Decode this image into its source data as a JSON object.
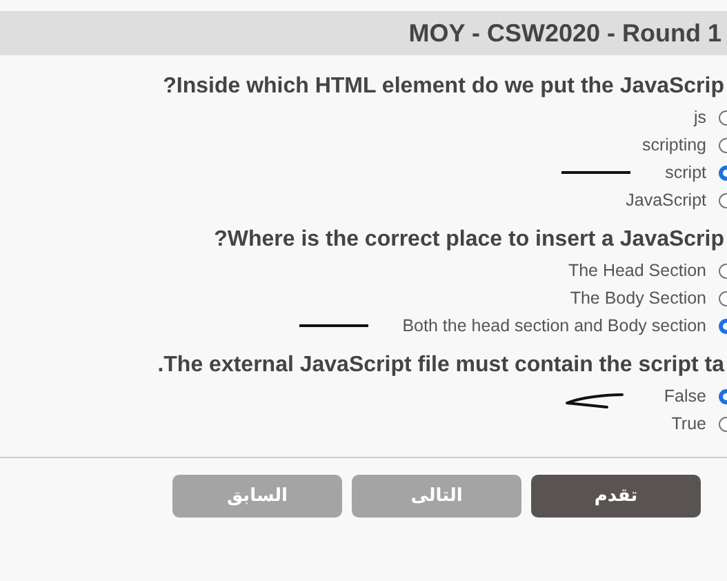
{
  "header": {
    "title": "MOY - CSW2020 - Round 1"
  },
  "questions": [
    {
      "text": "?Inside which HTML element do we put the JavaScrip",
      "options": [
        {
          "label": "js",
          "selected": false
        },
        {
          "label": "scripting",
          "selected": false
        },
        {
          "label": "script",
          "selected": true,
          "underlined": true
        },
        {
          "label": "JavaScript",
          "selected": false
        }
      ]
    },
    {
      "text": "?Where is the correct place to insert a JavaScrip",
      "options": [
        {
          "label": "The Head Section",
          "selected": false
        },
        {
          "label": "The Body Section",
          "selected": false
        },
        {
          "label": "Both the head section and Body section",
          "selected": true,
          "underlined": true
        }
      ]
    },
    {
      "text": ".The external JavaScript file must contain the script ta",
      "options": [
        {
          "label": "False",
          "selected": true,
          "arrowed": true
        },
        {
          "label": "True",
          "selected": false
        }
      ]
    }
  ],
  "buttons": [
    {
      "label": "تقدم",
      "disabled": false
    },
    {
      "label": "التالى",
      "disabled": true
    },
    {
      "label": "السابق",
      "disabled": true
    }
  ]
}
